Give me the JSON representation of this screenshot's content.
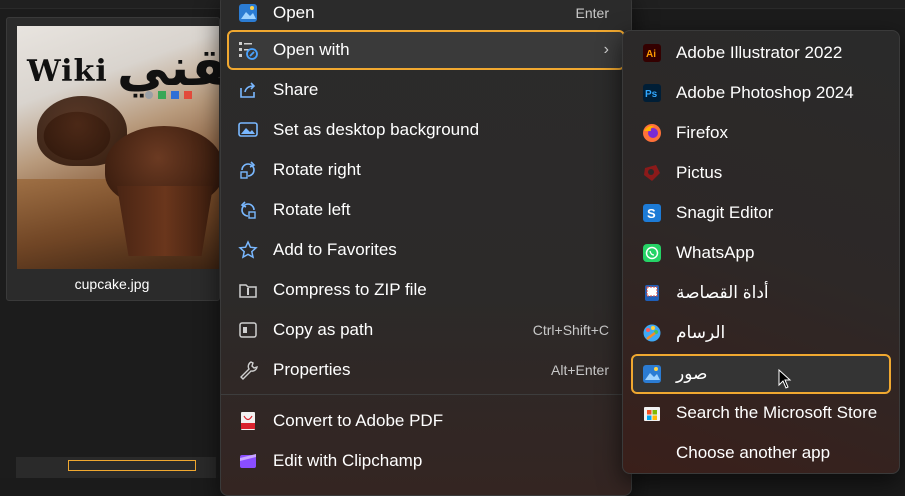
{
  "file": {
    "name": "cupcake.jpg",
    "logo_latin": "Wiki",
    "logo_arabic": "تقني"
  },
  "context_menu": {
    "items": [
      {
        "label": "Open",
        "shortcut": "Enter",
        "icon": "photos-icon"
      },
      {
        "label": "Open with",
        "shortcut": "",
        "icon": "open-with-icon",
        "has_submenu": true
      },
      {
        "label": "Share",
        "shortcut": "",
        "icon": "share-icon"
      },
      {
        "label": "Set as desktop background",
        "shortcut": "",
        "icon": "desktop-background-icon"
      },
      {
        "label": "Rotate right",
        "shortcut": "",
        "icon": "rotate-right-icon"
      },
      {
        "label": "Rotate left",
        "shortcut": "",
        "icon": "rotate-left-icon"
      },
      {
        "label": "Add to Favorites",
        "shortcut": "",
        "icon": "star-icon"
      },
      {
        "label": "Compress to ZIP file",
        "shortcut": "",
        "icon": "zip-folder-icon"
      },
      {
        "label": "Copy as path",
        "shortcut": "Ctrl+Shift+C",
        "icon": "copy-path-icon"
      },
      {
        "label": "Properties",
        "shortcut": "Alt+Enter",
        "icon": "wrench-icon"
      },
      {
        "label": "Convert to Adobe PDF",
        "shortcut": "",
        "icon": "adobe-pdf-icon"
      },
      {
        "label": "Edit with Clipchamp",
        "shortcut": "",
        "icon": "clipchamp-icon"
      }
    ]
  },
  "open_with_menu": {
    "items": [
      {
        "label": "Adobe Illustrator 2022",
        "icon": "illustrator-icon"
      },
      {
        "label": "Adobe Photoshop 2024",
        "icon": "photoshop-icon"
      },
      {
        "label": "Firefox",
        "icon": "firefox-icon"
      },
      {
        "label": "Pictus",
        "icon": "pictus-icon"
      },
      {
        "label": "Snagit Editor",
        "icon": "snagit-icon"
      },
      {
        "label": "WhatsApp",
        "icon": "whatsapp-icon"
      },
      {
        "label": "أداة القصاصة",
        "icon": "snipping-tool-icon"
      },
      {
        "label": "الرسام",
        "icon": "paint-icon"
      },
      {
        "label": "صور",
        "icon": "photos-icon",
        "highlighted": true
      },
      {
        "label": "Search the Microsoft Store",
        "icon": "microsoft-store-icon"
      },
      {
        "label": "Choose another app",
        "icon": ""
      }
    ]
  },
  "colors": {
    "highlight_outline": "#f0a830",
    "menu_bg": "#2b2b2b",
    "text": "#ffffff"
  }
}
